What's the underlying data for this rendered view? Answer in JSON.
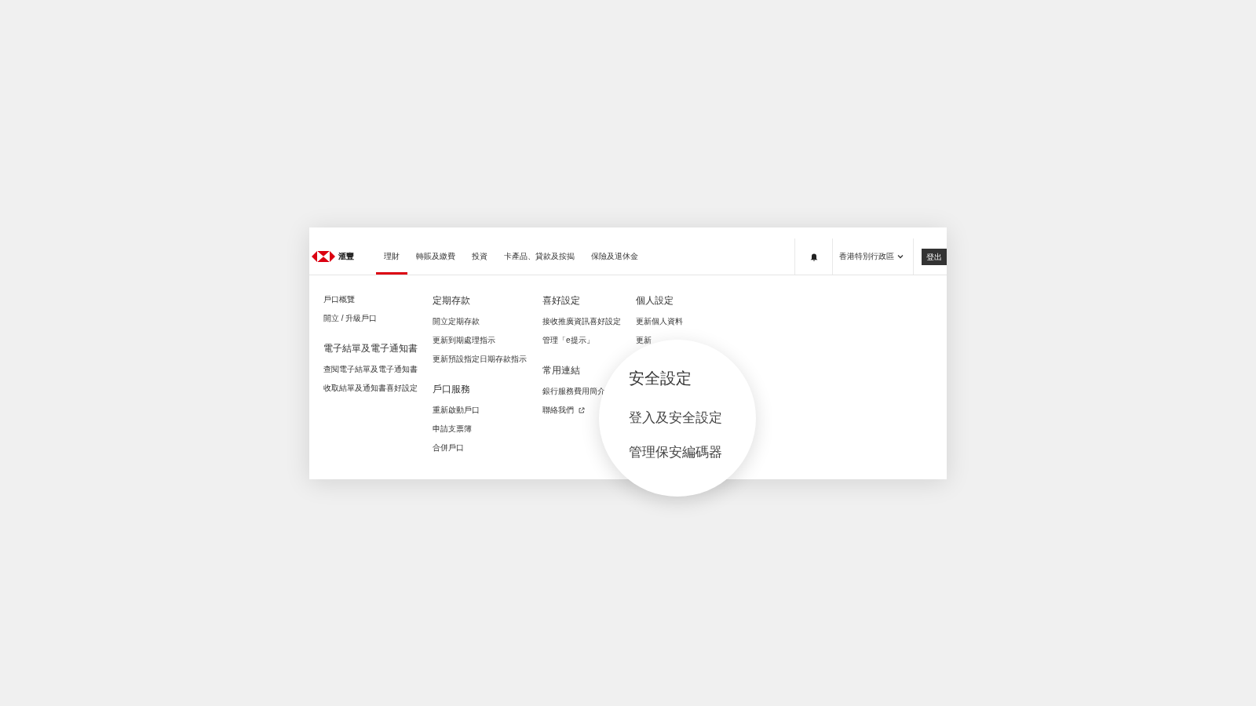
{
  "logo": {
    "text": "滙豐"
  },
  "nav": {
    "tabs": [
      {
        "label": "理財",
        "selected": true
      },
      {
        "label": "轉賬及繳費",
        "selected": false
      },
      {
        "label": "投資",
        "selected": false
      },
      {
        "label": "卡產品、貸款及按揭",
        "selected": false
      },
      {
        "label": "保險及退休金",
        "selected": false
      }
    ],
    "region": "香港特別行政區",
    "logout": "登出"
  },
  "menu": {
    "columns": [
      {
        "groups": [
          {
            "items": [
              {
                "label": "戶口概覽"
              },
              {
                "label": "開立 / 升級戶口"
              }
            ]
          },
          {
            "heading": "電子結單及電子通知書",
            "items": [
              {
                "label": "查閱電子結單及電子通知書"
              },
              {
                "label": "收取結單及通知書喜好設定"
              }
            ]
          }
        ]
      },
      {
        "groups": [
          {
            "heading": "定期存款",
            "items": [
              {
                "label": "開立定期存款"
              },
              {
                "label": "更新到期處理指示"
              },
              {
                "label": "更新預設指定日期存款指示"
              }
            ]
          },
          {
            "heading": "戶口服務",
            "items": [
              {
                "label": "重新啟動戶口"
              },
              {
                "label": "申請支票簿"
              },
              {
                "label": "合併戶口"
              }
            ]
          }
        ]
      },
      {
        "groups": [
          {
            "heading": "喜好設定",
            "items": [
              {
                "label": "接收推廣資訊喜好設定"
              },
              {
                "label": "管理「e提示」"
              }
            ]
          },
          {
            "heading": "常用連結",
            "items": [
              {
                "label": "銀行服務費用簡介"
              },
              {
                "label": "聯絡我們",
                "external": true
              }
            ]
          }
        ]
      },
      {
        "groups": [
          {
            "heading": "個人設定",
            "items": [
              {
                "label": "更新個人資料"
              },
              {
                "label": "更新"
              }
            ]
          }
        ]
      }
    ]
  },
  "magnifier": {
    "heading": "安全設定",
    "items": [
      "登入及安全設定",
      "管理保安編碼器"
    ]
  }
}
